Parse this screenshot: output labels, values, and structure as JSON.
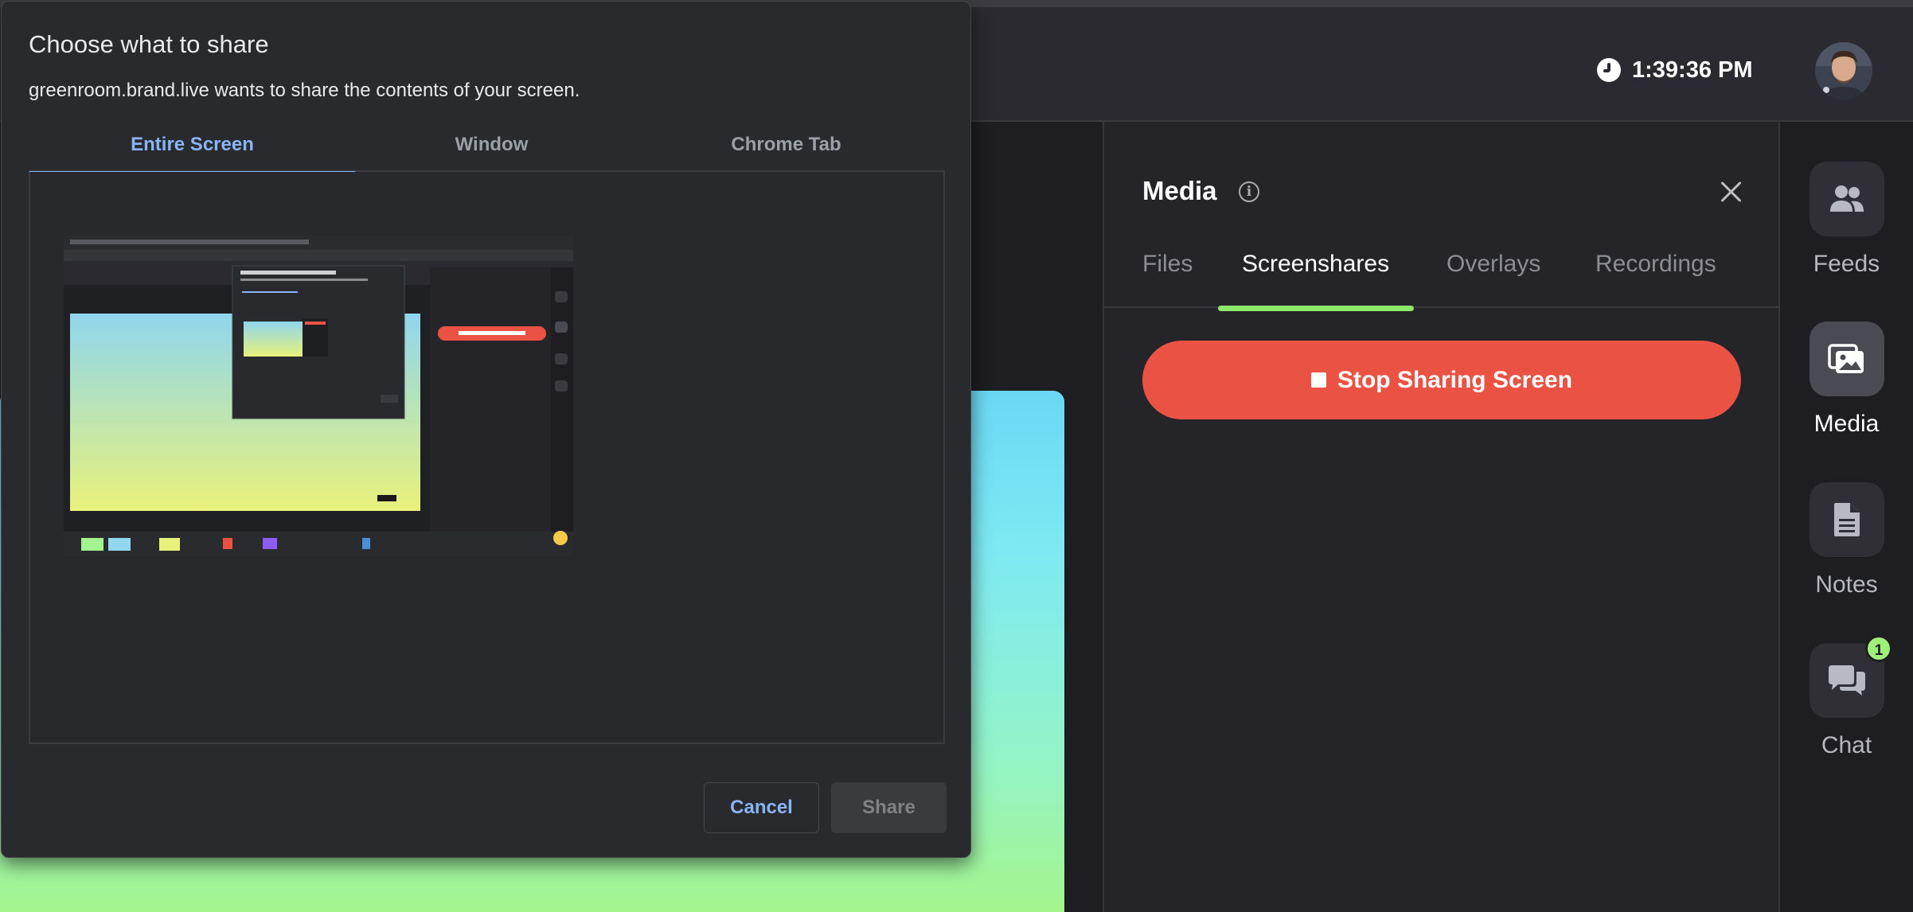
{
  "topbar": {
    "time": "1:39:36 PM"
  },
  "media": {
    "title": "Media",
    "tabs": [
      {
        "label": "Files"
      },
      {
        "label": "Screenshares"
      },
      {
        "label": "Overlays"
      },
      {
        "label": "Recordings"
      }
    ],
    "active_tab": "Screenshares",
    "stop_button_label": "Stop Sharing Screen"
  },
  "sidebar": {
    "items": [
      {
        "label": "Feeds",
        "icon": "people-icon"
      },
      {
        "label": "Media",
        "icon": "images-icon"
      },
      {
        "label": "Notes",
        "icon": "document-icon"
      },
      {
        "label": "Chat",
        "icon": "chat-bubbles-icon",
        "badge": "1"
      }
    ],
    "active_item": "Media"
  },
  "share_dialog": {
    "title": "Choose what to share",
    "subtitle": "greenroom.brand.live wants to share the contents of your screen.",
    "tabs": [
      {
        "label": "Entire Screen"
      },
      {
        "label": "Window"
      },
      {
        "label": "Chrome Tab"
      }
    ],
    "active_tab": "Entire Screen",
    "cancel_label": "Cancel",
    "share_label": "Share"
  },
  "colors": {
    "accent_green": "#8ee66a",
    "stop_red": "#ea5344",
    "dialog_blue": "#8ab4f8",
    "panel_bg": "#252529"
  }
}
